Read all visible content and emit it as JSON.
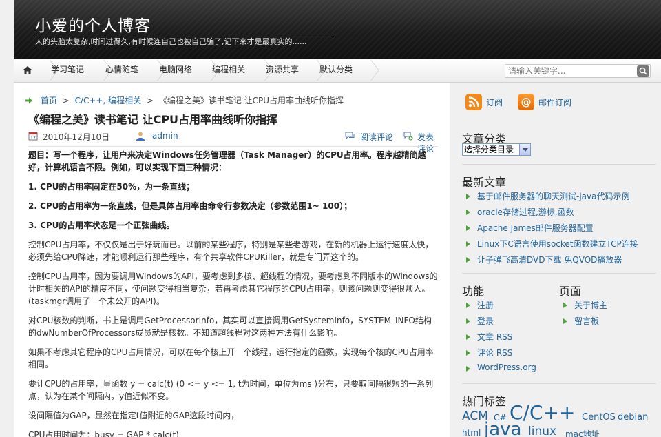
{
  "site": {
    "title": "小爱的个人博客",
    "description": "人的头脑太复杂,时间过得久,有时候连自己也被自己骗了,记下来才是最真实的......"
  },
  "nav": {
    "items": [
      "学习笔记",
      "心情随笔",
      "电脑网络",
      "编程相关",
      "资源共享",
      "默认分类"
    ],
    "search_placeholder": "请输入关键字..."
  },
  "breadcrumb": {
    "home": "首页",
    "sep": ">",
    "category": "C/C++, 编程相关",
    "current": "《编程之美》读书笔记 让CPU占用率曲线听你指挥"
  },
  "post": {
    "title": "《编程之美》读书笔记 让CPU占用率曲线听你指挥",
    "date": "2010年12月10日",
    "author": "admin",
    "read_comments": "阅读评论",
    "post_comment": "发表评论",
    "paragraphs": [
      {
        "text": "题目：写一个程序，让用户来决定Windows任务管理器（Task Manager）的CPU占用率。程序越精简越好，计算机语言不限。例如，可以实现下面三种情况：",
        "bold": true
      },
      {
        "text": "1. CPU的占用率固定在50%，为一条直线；",
        "bold": true
      },
      {
        "text": "2. CPU的占用率为一条直线，但是具体占用率由命令行参数决定（参数范围1~ 100）；",
        "bold": true
      },
      {
        "text": "3. CPU的占用率状态是一个正弦曲线。",
        "bold": true
      },
      {
        "text": "控制CPU占用率，不仅仅是出于好玩而已。以前的某些程序，特别是某些老游戏，在新的机器上运行速度太快，必须先给CPU降速，才能顺利运行那些程序，有个共享软件CPUKiller，就是专门弄这个的。",
        "bold": false
      },
      {
        "text": "控制CPU占用率，因为要调用Windows的API，要考虑到多核、超线程的情况，要考虑到不同版本的Windows的计时相关的API的精度不同，使问题变得相当复杂，若再考虑其它程序的CPU占用率，则该问题则变得很烦人。(taskmgr调用了一个未公开的API)。",
        "bold": false
      },
      {
        "text": "对CPU核数的判断，书上是调用GetProcessorInfo，其实可以直接调用GetSystemInfo，SYSTEM_INFO结构的dwNumberOfProcessors成员就是核数。不知道超线程对这两种方法有什么影响。",
        "bold": false
      },
      {
        "text": "如果不考虑其它程序的CPU占用情况，可以在每个核上开一个线程，运行指定的函数，实现每个核的CPU占用率相同。",
        "bold": false
      },
      {
        "text": "要让CPU的占用率，呈函数 y = calc(t) (0 <= y <= 1, t为时间，单位为ms )分布，只要取间隔很短的一系列点，认为在某个间隔内，y值近似不变。",
        "bold": false
      },
      {
        "text": "设间隔值为GAP，显然在指定t值附近的GAP这段时间内，",
        "bold": false
      },
      {
        "text": "CPU占用时间为：busy = GAP * calc(t)",
        "bold": false
      }
    ]
  },
  "sidebar": {
    "subscribe": "订阅",
    "email_subscribe": "邮件订阅",
    "categories_title": "文章分类",
    "categories_select": "选择分类目录",
    "recent_title": "最新文章",
    "recent": [
      "基于邮件服务器的聊天测试-java代码示例",
      "oracle存储过程,游标,函数",
      "Apache James邮件服务器配置",
      "Linux下C语言使用socket函数建立TCP连接",
      "让子弹飞高清DVD下载 免QVOD播放器"
    ],
    "meta_title": "功能",
    "meta": [
      "注册",
      "登录",
      "文章 RSS",
      "评论 RSS",
      "WordPress.org"
    ],
    "pages_title": "页面",
    "pages": [
      "关于博主",
      "留言板"
    ],
    "tags_title": "热门标签",
    "tags": [
      "ACM",
      "C#",
      "C/C++",
      "CentOS",
      "debian",
      "html",
      "java",
      "linux",
      "mac地址"
    ]
  },
  "colors": {
    "link": "#21639b",
    "bullet": "#4ea23a",
    "header_bg": "#1c1c1c",
    "accent_orange": "#f08a1c"
  }
}
